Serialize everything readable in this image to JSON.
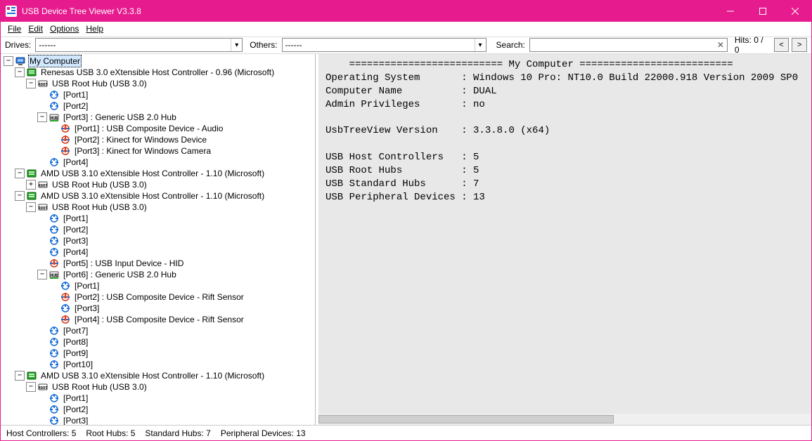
{
  "title": "USB Device Tree Viewer V3.3.8",
  "menu": {
    "file": "File",
    "edit": "Edit",
    "options": "Options",
    "help": "Help"
  },
  "toolbar": {
    "drives_label": "Drives:",
    "drives_value": "------",
    "others_label": "Others:",
    "others_value": "------",
    "search_label": "Search:",
    "search_value": "",
    "hits_label": "Hits: 0 / 0",
    "prev": "<",
    "next": ">"
  },
  "tree": {
    "root": "My Computer",
    "c1": {
      "label": "Renesas USB 3.0 eXtensible Host Controller - 0.96 (Microsoft)",
      "roothub": {
        "label": "USB Root Hub (USB 3.0)",
        "p1": "[Port1]",
        "p2": "[Port2]",
        "p3": {
          "label": "[Port3] : Generic USB 2.0 Hub",
          "p1": "[Port1] : USB Composite Device - Audio",
          "p2": "[Port2] : Kinect for Windows Device",
          "p3": "[Port3] : Kinect for Windows Camera"
        },
        "p4": "[Port4]"
      }
    },
    "c2": {
      "label": "AMD USB 3.10 eXtensible Host Controller - 1.10 (Microsoft)",
      "roothub": {
        "label": "USB Root Hub (USB 3.0)"
      }
    },
    "c3": {
      "label": "AMD USB 3.10 eXtensible Host Controller - 1.10 (Microsoft)",
      "roothub": {
        "label": "USB Root Hub (USB 3.0)",
        "p1": "[Port1]",
        "p2": "[Port2]",
        "p3": "[Port3]",
        "p4": "[Port4]",
        "p5": "[Port5] : USB Input Device - HID",
        "p6": {
          "label": "[Port6] : Generic USB 2.0 Hub",
          "p1": "[Port1]",
          "p2": "[Port2] : USB Composite Device - Rift Sensor",
          "p3": "[Port3]",
          "p4": "[Port4] : USB Composite Device - Rift Sensor"
        },
        "p7": "[Port7]",
        "p8": "[Port8]",
        "p9": "[Port9]",
        "p10": "[Port10]"
      }
    },
    "c4": {
      "label": "AMD USB 3.10 eXtensible Host Controller - 1.10 (Microsoft)",
      "roothub": {
        "label": "USB Root Hub (USB 3.0)",
        "p1": "[Port1]",
        "p2": "[Port2]",
        "p3": "[Port3]"
      }
    }
  },
  "details": {
    "header": "========================== My Computer ==========================",
    "lines": [
      "Operating System       : Windows 10 Pro: NT10.0 Build 22000.918 Version 2009 SP0",
      "Computer Name          : DUAL",
      "Admin Privileges       : no",
      "",
      "UsbTreeView Version    : 3.3.8.0 (x64)",
      "",
      "USB Host Controllers   : 5",
      "USB Root Hubs          : 5",
      "USB Standard Hubs      : 7",
      "USB Peripheral Devices : 13"
    ]
  },
  "status": {
    "host_controllers": "Host Controllers: 5",
    "root_hubs": "Root Hubs: 5",
    "standard_hubs": "Standard Hubs: 7",
    "peripheral_devices": "Peripheral Devices: 13"
  }
}
